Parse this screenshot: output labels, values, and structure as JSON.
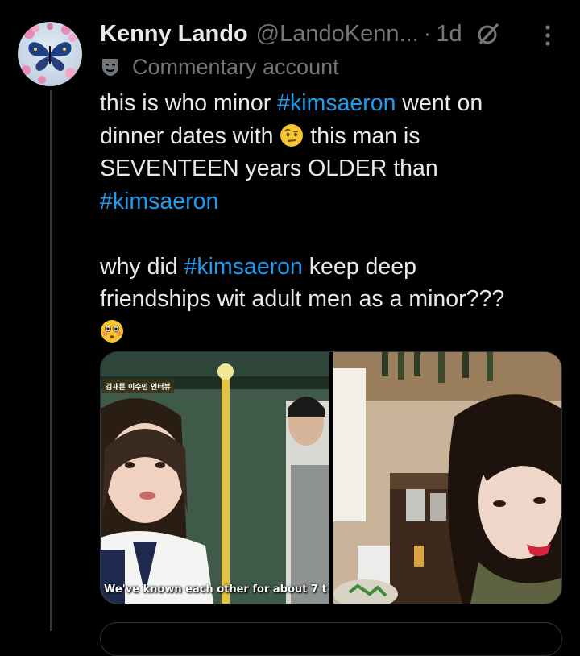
{
  "author": {
    "display_name": "Kenny Lando",
    "handle": "@LandoKenn...",
    "separator": "·",
    "timestamp": "1d",
    "label": "Commentary account"
  },
  "tweet": {
    "line1_prefix": "this is who minor ",
    "line1_hashtag": "#kimsaeron",
    "line1_suffix": " went on",
    "line2_prefix": "dinner dates with ",
    "line2_suffix": " this man is",
    "line3": "SEVENTEEN years OLDER than",
    "line4_hashtag": "#kimsaeron",
    "line5_prefix": "why did ",
    "line5_hashtag": "#kimsaeron",
    "line5_suffix": " keep deep",
    "line6": "friendships wit adult men as a minor???"
  },
  "media": {
    "left_caption": "We've known each other for about 7 t",
    "left_tag": "김새론 이수민 인터뷰"
  },
  "icons": {
    "grok": "grok-icon",
    "more": "more-vertical-icon",
    "commentary": "mask-icon",
    "raised_eyebrow": "face-with-raised-eyebrow-emoji",
    "flushed": "flushed-face-emoji"
  },
  "colors": {
    "background": "#000000",
    "text": "#e7e9ea",
    "secondary": "#71767b",
    "hashtag": "#1d9bf0"
  }
}
